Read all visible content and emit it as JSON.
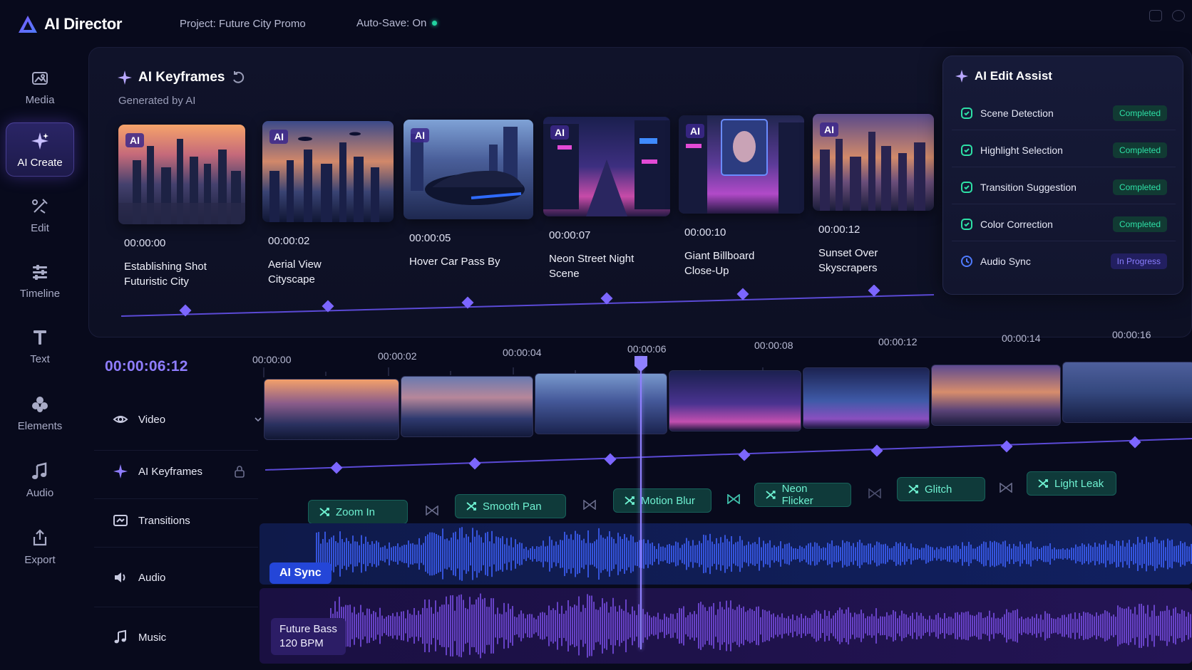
{
  "app": {
    "name": "AI Director",
    "project": "Project: Future City Promo",
    "autosave": "Auto-Save: On"
  },
  "sidebar": {
    "items": [
      {
        "label": "Media",
        "icon": "media-icon"
      },
      {
        "label": "AI Create",
        "icon": "sparkle-icon",
        "active": true
      },
      {
        "label": "Edit",
        "icon": "edit-tools-icon"
      },
      {
        "label": "Timeline",
        "icon": "timeline-sliders-icon"
      },
      {
        "label": "Text",
        "icon": "text-icon"
      },
      {
        "label": "Elements",
        "icon": "elements-icon"
      },
      {
        "label": "Audio",
        "icon": "music-note-icon"
      },
      {
        "label": "Export",
        "icon": "export-icon"
      }
    ]
  },
  "keyframes": {
    "title": "AI Keyframes",
    "subtitle": "Generated by AI",
    "items": [
      {
        "time": "00:00:00",
        "name": "Establishing Shot Futuristic City",
        "badge": "AI"
      },
      {
        "time": "00:00:02",
        "name": "Aerial View Cityscape",
        "badge": "AI"
      },
      {
        "time": "00:00:05",
        "name": "Hover Car Pass By",
        "badge": "AI"
      },
      {
        "time": "00:00:07",
        "name": "Neon Street Night Scene",
        "badge": "AI"
      },
      {
        "time": "00:00:10",
        "name": "Giant Billboard Close-Up",
        "badge": "AI"
      },
      {
        "time": "00:00:12",
        "name": "Sunset Over Skyscrapers",
        "badge": "AI"
      }
    ]
  },
  "assist": {
    "title": "AI Edit Assist",
    "rows": [
      {
        "label": "Scene Detection",
        "status": "Completed"
      },
      {
        "label": "Highlight Selection",
        "status": "Completed"
      },
      {
        "label": "Transition Suggestion",
        "status": "Completed"
      },
      {
        "label": "Color Correction",
        "status": "Completed"
      },
      {
        "label": "Audio Sync",
        "status": "In Progress"
      }
    ]
  },
  "timeline": {
    "timecode": "00:00:06:12",
    "ruler": [
      "00:00:00",
      "00:00:02",
      "00:00:04",
      "00:00:06",
      "00:00:08",
      "00:00:12",
      "00:00:14",
      "00:00:16"
    ],
    "tracks": {
      "video": "Video",
      "keyframes": "AI Keyframes",
      "transitions": "Transitions",
      "audio": "Audio",
      "music": "Music"
    },
    "effects": [
      "Zoom In",
      "Smooth Pan",
      "Motion Blur",
      "Neon Flicker",
      "Glitch",
      "Light Leak"
    ],
    "audio_pill": "AI Sync",
    "music_pill": {
      "line1": "Future Bass",
      "line2": "120 BPM"
    }
  },
  "colors": {
    "accent": "#8f7dff",
    "status_done": "#2ee0a6",
    "status_progress": "#8a7eff",
    "fx": "#6ff2d2"
  }
}
